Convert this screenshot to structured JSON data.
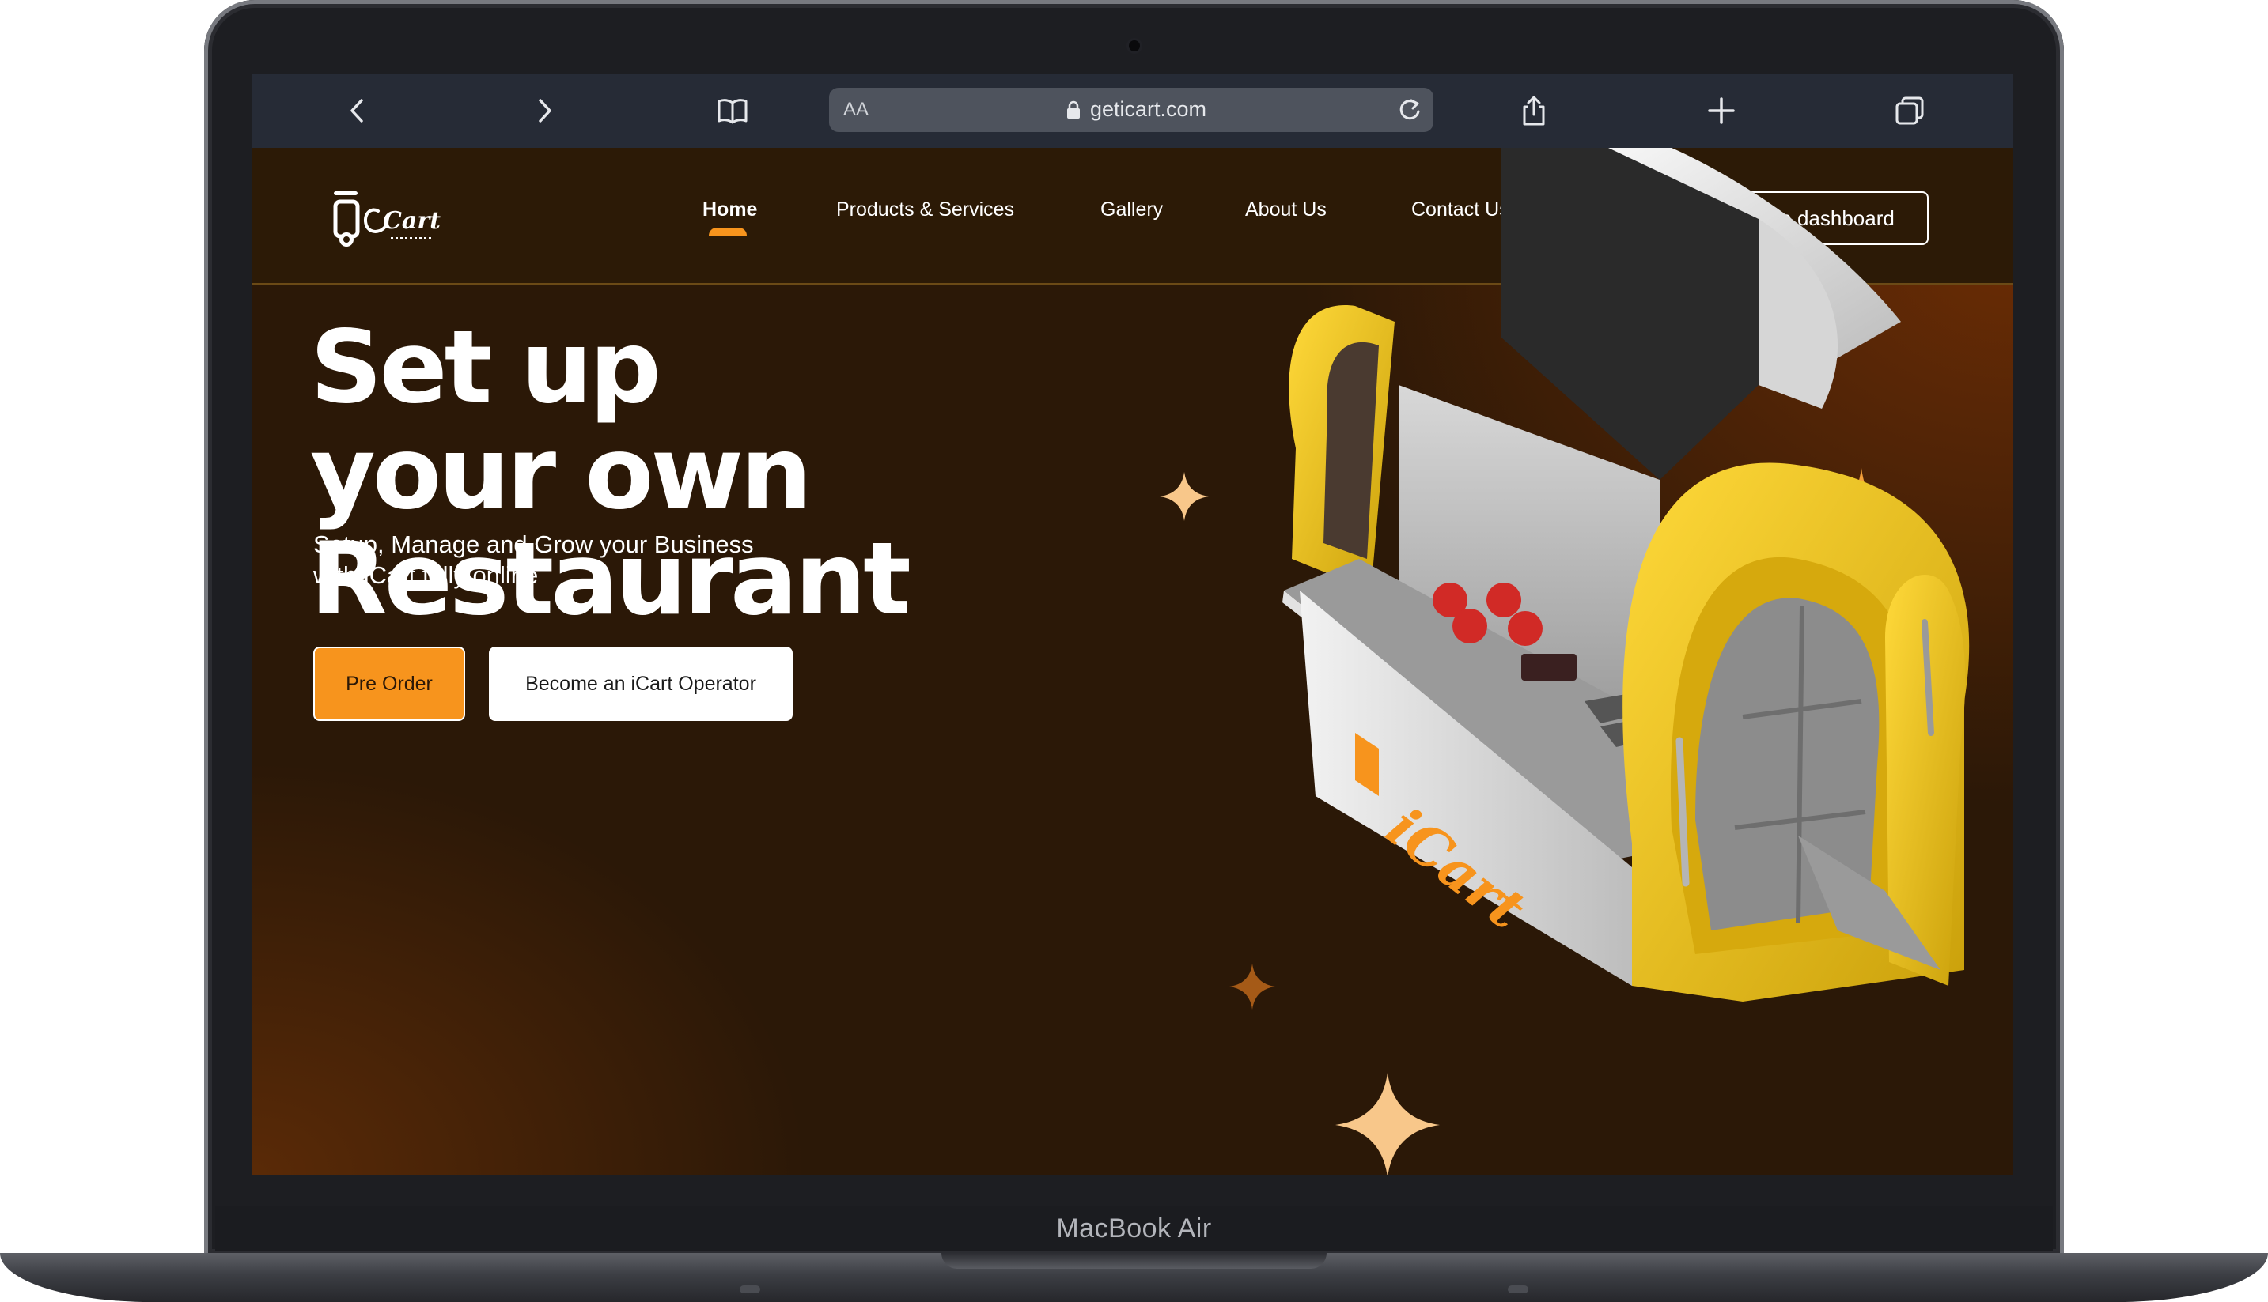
{
  "browser": {
    "address_aa": "AA",
    "url": "geticart.com"
  },
  "site": {
    "logo_text": "Cart",
    "nav": [
      {
        "label": "Home",
        "active": true
      },
      {
        "label": "Products & Services",
        "active": false
      },
      {
        "label": "Gallery",
        "active": false
      },
      {
        "label": "About Us",
        "active": false
      },
      {
        "label": "Contact Us",
        "active": false
      }
    ],
    "dashboard_button": "Go to dashboard"
  },
  "hero": {
    "title_lines": [
      "Set up",
      "your own",
      "Restaurant"
    ],
    "subtitle_lines": [
      "Setup, Manage and Grow your Business",
      "with iCart fully online"
    ],
    "pre_order_button": "Pre Order",
    "operator_button": "Become an iCart Operator",
    "cart_brand_text": "iCart"
  },
  "device": {
    "label": "MacBook Air"
  },
  "colors": {
    "accent": "#f7941d",
    "page_bg": "#2b1807",
    "toolbar_bg": "#262b36",
    "cart_yellow": "#f3c316",
    "sparkle_light": "#f8c78a"
  },
  "icons": [
    "back-chevron-icon",
    "forward-chevron-icon",
    "bookmarks-book-icon",
    "lock-icon",
    "reload-icon",
    "share-icon",
    "new-tab-plus-icon",
    "tabs-overview-icon",
    "sparkle-icon"
  ]
}
